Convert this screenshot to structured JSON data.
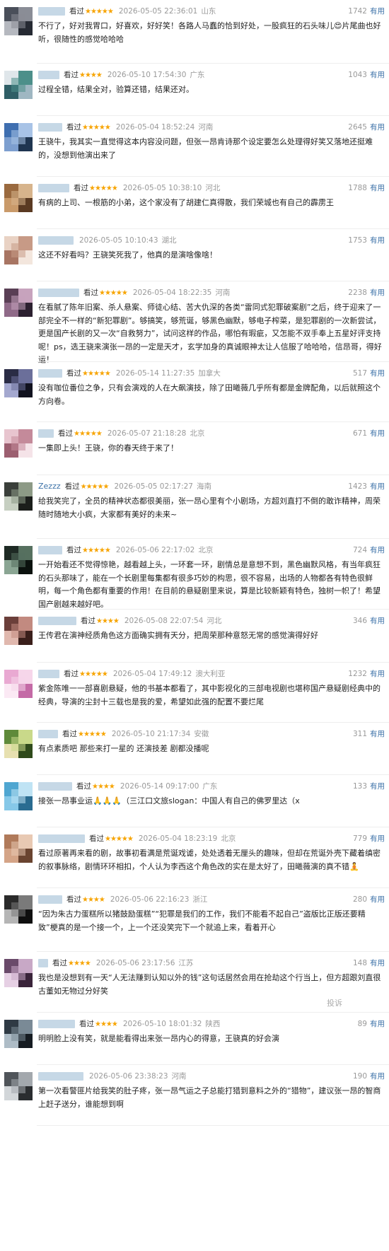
{
  "reviews": [
    {
      "user_width": 38,
      "user_text": "",
      "seen": "看过",
      "stars": "★★★★★",
      "time": "2026-05-05 22:36:01",
      "loc": "山东",
      "count": "1742",
      "useful": "有用",
      "text": "不行了，好对我胃口，好喜欢，好好笑！各路人马蠢的恰到好处，一股疯狂的石头味儿😍片尾曲也好听，很随性的感觉哈哈哈",
      "avatar": [
        "#4a4f5a",
        "#8a8d96",
        "#262a33",
        "#b5b8bf"
      ]
    },
    {
      "user_width": 30,
      "user_text": "",
      "seen": "看过",
      "stars": "★★★★",
      "time": "2026-05-10 17:54:30",
      "loc": "广东",
      "count": "1043",
      "useful": "有用",
      "text": "过程全错，结果全对，验算还错，结果还对。",
      "avatar": [
        "#dfe6ea",
        "#4c8f8a",
        "#9fb7c2",
        "#2f5e66"
      ]
    },
    {
      "user_width": 34,
      "user_text": "",
      "seen": "看过",
      "stars": "★★★★★",
      "time": "2026-05-04 18:52:24",
      "loc": "河南",
      "count": "2645",
      "useful": "有用",
      "text": "王骁牛，我其实一直觉得这本内容没问题，但张一昂肯诗那个设定要怎么处理得好笑又落地还挺难的，没想到他演出来了",
      "avatar": [
        "#3f6fb0",
        "#a8c3e6",
        "#1f3550",
        "#7d9fcf"
      ]
    },
    {
      "user_width": 44,
      "user_text": "",
      "seen": "看过",
      "stars": "★★★★★",
      "time": "2026-05-05 10:38:10",
      "loc": "河北",
      "count": "1788",
      "useful": "有用",
      "text": "有病的上司、一根筋的小弟，这个家没有了胡建仁真得散，我们荣城也有自己的霹雳王",
      "avatar": [
        "#9a6a3f",
        "#d7b48c",
        "#5a3a22",
        "#c99a6a"
      ]
    },
    {
      "user_width": 50,
      "user_text": "",
      "seen": "",
      "stars": "",
      "time": "2026-05-05 10:10:43",
      "loc": "湖北",
      "count": "1753",
      "useful": "有用",
      "text": "这还不好看吗？王骁笑死我了，他真的是演啥像啥！",
      "avatar": [
        "#e9d2c4",
        "#c79a86",
        "#f3e6dd",
        "#a87563"
      ]
    },
    {
      "user_width": 58,
      "user_text": "",
      "seen": "看过",
      "stars": "★★★★★",
      "time": "2026-05-04 18:22:35",
      "loc": "河南",
      "count": "2238",
      "useful": "有用",
      "text": "在看腻了陈年旧案、杀人悬案、师徒心结、苦大仇深的各类“雷同式犯罪破案剧”之后，终于迎来了一部完全不一样的“新犯罪剧”。够搞笑，够荒诞，够黑色幽默，够电子榨菜，是犯罪剧的一次新尝试，更是国产长剧的又一次“自救努力”，试问这样的作品，哪怕有瑕疵，又怎能不双手奉上五星好评支持呢！ps，选王骁来演张一昂的一定是天才，玄学加身的真诚眼神太让人信服了哈哈哈，信昂哥，得好运！",
      "avatar": [
        "#5a3f55",
        "#c7a3bd",
        "#2c2030",
        "#8f6a88"
      ]
    },
    {
      "user_width": 34,
      "user_text": "",
      "seen": "看过",
      "stars": "★★★★★",
      "time": "2026-05-14 11:27:35",
      "loc": "加拿大",
      "count": "517",
      "useful": "有用",
      "text": "没有咖位番位之争，只有会演戏的人在大飙演技，除了田曦薇几乎所有都是金牌配角，以后就照这个方向卷。",
      "avatar": [
        "#2a2c45",
        "#6b6f9a",
        "#11121f",
        "#a4a8cf"
      ]
    },
    {
      "user_width": 22,
      "user_text": "",
      "seen": "看过",
      "stars": "★★★★★",
      "time": "2026-05-07 21:18:28",
      "loc": "北京",
      "count": "671",
      "useful": "有用",
      "text": "一集即上头！王骁，你的春天终于来了！",
      "avatar": [
        "#e8c5cf",
        "#c48a9a",
        "#f5e3e8",
        "#9c5f70"
      ]
    },
    {
      "user_width": 0,
      "user_text": "Zezzz",
      "seen": "看过",
      "stars": "★★★★★",
      "time": "2026-05-05 02:17:27",
      "loc": "海南",
      "count": "1423",
      "useful": "有用",
      "text": "给我笑完了，全员的精神状态都很美丽，张一昂心里有个小剧场，方超刘直打不倒的敢诈精神，周荣随时随地大小疯，大家都有美好的未来~",
      "avatar": [
        "#3a3f3a",
        "#8d9a86",
        "#1b1e1b",
        "#c6cfc1"
      ]
    },
    {
      "user_width": 34,
      "user_text": "",
      "seen": "看过",
      "stars": "★★★★★",
      "time": "2026-05-06 22:17:02",
      "loc": "北京",
      "count": "724",
      "useful": "有用",
      "text": "一开始看还不觉得惊艳，越看越上头，一环套一环，剧情总是意想不到，黑色幽默风格，有当年疯狂的石头那味了，能在一个长剧里每集都有很多巧妙的构思，很不容易，出场的人物都各有特色很鲜明，每一个角色都有重要的作用！在目前的悬疑剧里来说，算是比较新颖有特色，独树一帜了！希望国产剧越来越好吧。",
      "avatar": [
        "#1e2a24",
        "#56705f",
        "#0b120e",
        "#8aa593"
      ]
    },
    {
      "user_width": 54,
      "user_text": "",
      "seen": "看过",
      "stars": "★★★★",
      "time": "2026-05-08 22:07:54",
      "loc": "河北",
      "count": "346",
      "useful": "有用",
      "text": "王传君在演神经质角色这方面确实拥有天分，把周荣那种意怒无常的感觉演得好好",
      "avatar": [
        "#6b3f3a",
        "#c28a80",
        "#3a1f1b",
        "#e0b8ae"
      ]
    },
    {
      "user_width": 30,
      "user_text": "",
      "seen": "看过",
      "stars": "★★★★★",
      "time": "2026-05-04 17:49:12",
      "loc": "澳大利亚",
      "count": "1232",
      "useful": "有用",
      "text": "紫金陈唯一一部喜剧悬疑，他的书基本都看了，其中影视化的三部电视剧也堪称国产悬疑剧经典中的经典，导演的尘封十三载也是我的爱，希望如此强的配置不要烂尾",
      "avatar": [
        "#e9a9d2",
        "#f6d6ea",
        "#c46aa6",
        "#fbe9f4"
      ]
    },
    {
      "user_width": 28,
      "user_text": "",
      "seen": "看过",
      "stars": "★★★★★",
      "time": "2026-05-10 21:17:34",
      "loc": "安徽",
      "count": "311",
      "useful": "有用",
      "text": "有点素质吧 那些来打一星的 还演技差 剧都没播呢",
      "avatar": [
        "#5f8a3a",
        "#c9d98a",
        "#2f4a1b",
        "#e7e0b0"
      ]
    },
    {
      "user_width": 48,
      "user_text": "",
      "seen": "看过",
      "stars": "★★★★",
      "time": "2026-05-14 09:17:00",
      "loc": "广东",
      "count": "133",
      "useful": "有用",
      "text": "接张一昂事业运🙏🙏🙏（三江口文旅slogan：中国人有自己的佛罗里达（x",
      "avatar": [
        "#4fa6d1",
        "#bfe3f4",
        "#2a6c91",
        "#86c8e8"
      ]
    },
    {
      "user_width": 66,
      "user_text": "",
      "seen": "看过",
      "stars": "★★★★★",
      "time": "2026-05-04 18:23:19",
      "loc": "北京",
      "count": "779",
      "useful": "有用",
      "text": "看过原著再来看的剧，故事初看满是荒诞戏谑，处处透着无厘头的趣味，但却在荒诞外壳下藏着缜密的叙事脉络，剧情环环相扣，个人认为李西这个角色改的实在是太好了，田曦薇演的真不错🧘",
      "avatar": [
        "#b07a5a",
        "#e8c9b3",
        "#6a4430",
        "#d4a487"
      ]
    },
    {
      "user_width": 34,
      "user_text": "",
      "seen": "看过",
      "stars": "★★★★",
      "time": "2026-05-06 22:16:23",
      "loc": "浙江",
      "count": "280",
      "useful": "有用",
      "text": "“因为朱古力蛋糕所以猪鼓励蛋糕”“犯罪是我们的工作，我们不能看不起自己”盗版比正版还要精致”梗真的是一个接一个，上一个还没笑完下一个就追上来，看着开心",
      "avatar": [
        "#2a2a2a",
        "#7a7a7a",
        "#0f0f0f",
        "#b5b5b5"
      ]
    },
    {
      "user_width": 14,
      "user_text": "",
      "seen": "看过",
      "stars": "★★★★",
      "time": "2026-05-06 23:17:56",
      "loc": "江苏",
      "count": "148",
      "useful": "有用",
      "text": "我也是没想到有一天“人无法赚到认知以外的钱”这句话居然会用在抢劫这个行当上，但方超跟刘直很古董如无物过分好笑",
      "avatar": [
        "#6a4a6a",
        "#c8a8c6",
        "#3a243a",
        "#e6d0e4"
      ]
    },
    {
      "user_width": 52,
      "user_text": "",
      "seen": "看过",
      "stars": "★★★★",
      "time": "2026-05-10 18:01:32",
      "loc": "陕西",
      "count": "89",
      "useful": "有用",
      "text": "明明脸上没有笑，就是能看得出来张一昂内心的得意，王骁真的好会演",
      "avatar": [
        "#2f3a44",
        "#7a8a96",
        "#161c22",
        "#aebcc6"
      ]
    },
    {
      "user_width": 64,
      "user_text": "",
      "seen": "",
      "stars": "",
      "time": "2026-05-06 23:38:23",
      "loc": "河南",
      "count": "190",
      "useful": "有用",
      "text": "第一次看警匪片给我笑的肚子疼，张一昂气运之子总能打猎到意料之外的“猎物”，建议张一昂的智商上赶子送分，谁能想到啊",
      "avatar": [
        "#50555a",
        "#a3a8ad",
        "#2a2d30",
        "#d2d6d9"
      ]
    }
  ],
  "report_label": "投诉"
}
